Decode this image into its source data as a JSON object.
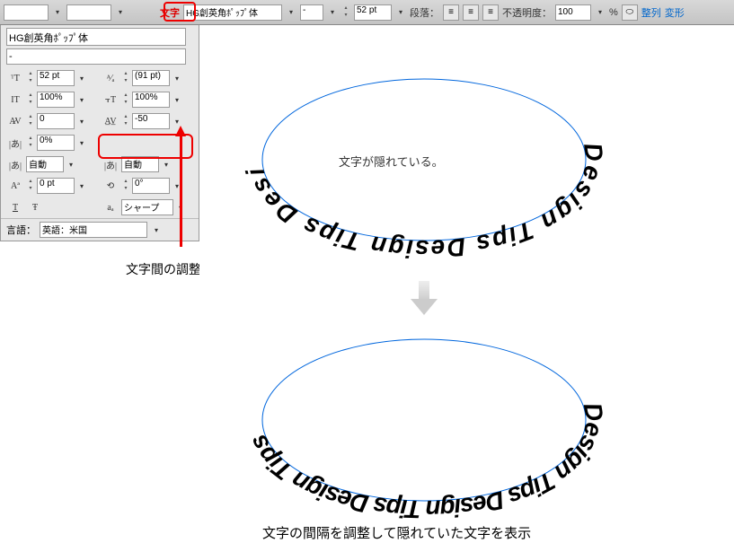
{
  "toolbar": {
    "char_tab": "文字",
    "font_family": "HG創英角ﾎﾟｯﾌﾟ体",
    "style": "-",
    "size": "52 pt",
    "para_label": "段落：",
    "opacity_label": "不透明度：",
    "opacity_value": "100",
    "opacity_unit": "%",
    "align_btn": "整列",
    "transform_btn": "変形"
  },
  "panel": {
    "font_family": "HG創英角ﾎﾟｯﾌﾟ体",
    "font_style": "-",
    "font_size": "52 pt",
    "leading": "(91 pt)",
    "vscale": "100%",
    "hscale": "100%",
    "kerning": "0",
    "tracking": "-50",
    "baseline": "0%",
    "auto1": "自動",
    "auto2": "自動",
    "shift": "0 pt",
    "rotation": "0°",
    "sharp": "シャープ",
    "lang_label": "言語：",
    "lang_value": "英語：米国"
  },
  "annotations": {
    "kerning_adj": "文字間の調整",
    "hidden_text": "文字が隠れている。",
    "result_text": "文字の間隔を調整して隠れていた文字を表示"
  },
  "curved": {
    "path_text": "Design Tips Design Tips Design Tips Design Tips"
  }
}
